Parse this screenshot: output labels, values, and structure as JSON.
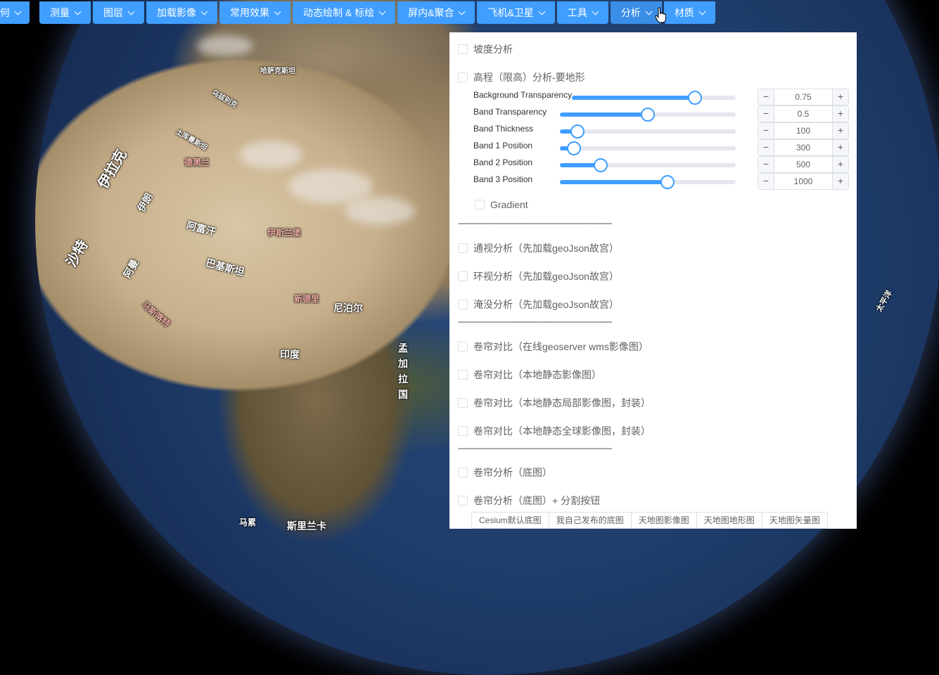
{
  "menu": [
    {
      "label": "几何"
    },
    {
      "label": "测量"
    },
    {
      "label": "图层"
    },
    {
      "label": "加载影像"
    },
    {
      "label": "常用效果"
    },
    {
      "label": "动态绘制 & 标绘"
    },
    {
      "label": "屏内&聚合"
    },
    {
      "label": "飞机&卫星"
    },
    {
      "label": "工具"
    },
    {
      "label": "分析",
      "active": true
    },
    {
      "label": "材质"
    }
  ],
  "panel": {
    "slope": "坡度分析",
    "elevation": "高程（限高）分析-要地形",
    "sliders": [
      {
        "label": "Background Transparency",
        "value": "0.75",
        "fraction": 0.75
      },
      {
        "label": "Band Transparency",
        "value": "0.5",
        "fraction": 0.5
      },
      {
        "label": "Band Thickness",
        "value": "100",
        "fraction": 0.1
      },
      {
        "label": "Band 1 Position",
        "value": "300",
        "fraction": 0.08
      },
      {
        "label": "Band 2 Position",
        "value": "500",
        "fraction": 0.23
      },
      {
        "label": "Band 3 Position",
        "value": "1000",
        "fraction": 0.61
      }
    ],
    "gradient": "Gradient",
    "separator": "----------------------------------------------------------------------------------",
    "analysis_items": [
      "通视分析（先加载geoJson故宫）",
      "环视分析（先加载geoJson故宫）",
      "淹没分析（先加载geoJson故宫）"
    ],
    "swipe_items": [
      "卷帘对比（在线geoserver wms影像图）",
      "卷帘对比（本地静态影像图）",
      "卷帘对比（本地静态局部影像图，封装）",
      "卷帘对比（本地静态全球影像图，封装）"
    ],
    "split_items": [
      "卷帘分析（底图）",
      "卷帘分析（底图）+ 分割按钮"
    ],
    "basemap_buttons": [
      "Cesium默认底图",
      "我自己发布的底图",
      "天地图影像图",
      "天地图地形图",
      "天地图矢量图"
    ]
  },
  "map_labels": [
    {
      "text": "伊拉克"
    },
    {
      "text": "伊朗"
    },
    {
      "text": "沙特"
    },
    {
      "text": "阿富汗"
    },
    {
      "text": "巴基斯坦"
    },
    {
      "text": "印度"
    },
    {
      "text": "尼泊尔"
    },
    {
      "text": "孟加拉国"
    },
    {
      "text": "阿曼"
    },
    {
      "text": "太平洋"
    },
    {
      "text": "德黑兰"
    },
    {
      "text": "马斯喀特"
    },
    {
      "text": "伊斯兰堡"
    },
    {
      "text": "新德里"
    },
    {
      "text": "斯里兰卡"
    },
    {
      "text": "哈萨克斯坦"
    },
    {
      "text": "土库曼斯坦"
    },
    {
      "text": "乌兹别克"
    },
    {
      "text": "马累"
    }
  ]
}
